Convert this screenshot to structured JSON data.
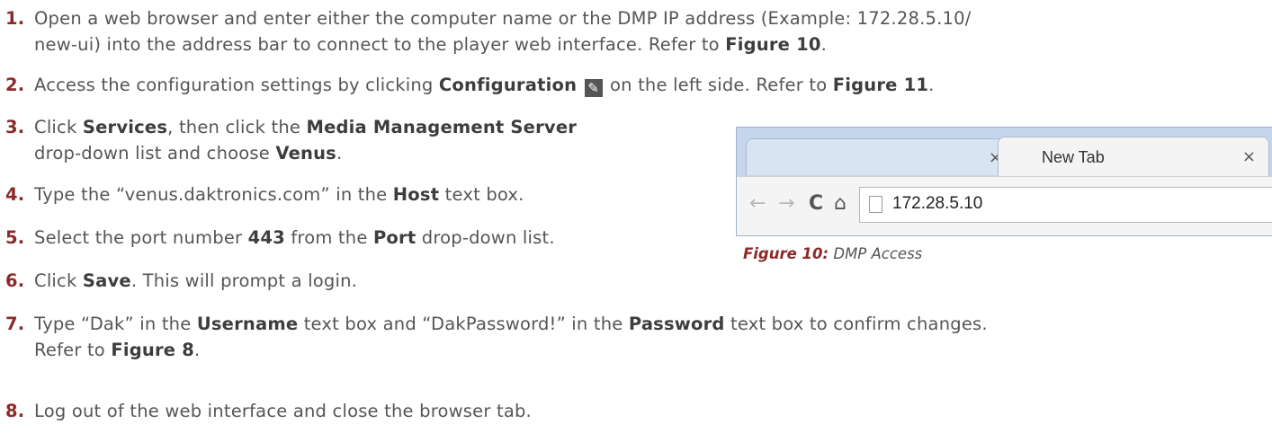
{
  "steps": [
    {
      "num": "1.",
      "line1": "Open a web browser and enter either the computer name or the DMP IP address (Example: 172.28.5.10/",
      "line2_pre": "new-ui) into the address bar to connect to the player web interface. Refer to ",
      "line2_bold": "Figure 10",
      "line2_post": "."
    },
    {
      "num": "2.",
      "pre": "Access the configuration settings by clicking ",
      "bold1": "Configuration",
      "icon": "wrench-icon",
      "mid": " on the left side. Refer to ",
      "bold2": "Figure 11",
      "post": "."
    },
    {
      "num": "3.",
      "pre": "Click ",
      "bold1": "Services",
      "mid": ", then click the ",
      "bold2": "Media Management Server",
      "line2_pre": "drop-down list and choose ",
      "line2_bold": "Venus",
      "line2_post": "."
    },
    {
      "num": "4.",
      "pre": "Type the “venus.daktronics.com” in the ",
      "bold1": "Host",
      "post": " text box."
    },
    {
      "num": "5.",
      "pre": "Select the port number ",
      "bold1": "443",
      "mid": " from the ",
      "bold2": "Port",
      "post": " drop-down list."
    },
    {
      "num": "6.",
      "pre": "Click ",
      "bold1": "Save",
      "post": ". This will prompt a login."
    },
    {
      "num": "7.",
      "pre": "Type “Dak” in the ",
      "bold1": "Username",
      "mid": " text box and “DakPassword!” in the ",
      "bold2": "Password",
      "post": " text box to confirm changes.",
      "line2_pre": "Refer to ",
      "line2_bold": "Figure 8",
      "line2_post": "."
    },
    {
      "num": "8.",
      "text": "Log out of the web interface and close the browser tab."
    }
  ],
  "figure": {
    "tab_close": "×",
    "active_tab_label": "New Tab",
    "nav_back": "←",
    "nav_forward": "→",
    "nav_reload": "C",
    "nav_home": "⌂",
    "url": "172.28.5.10",
    "caption_bold": "Figure 10:",
    "caption_text": " DMP Access"
  },
  "colors": {
    "step_number": "#8a2a2a",
    "body_text": "#555555",
    "browser_frame": "#c5d6ec"
  }
}
